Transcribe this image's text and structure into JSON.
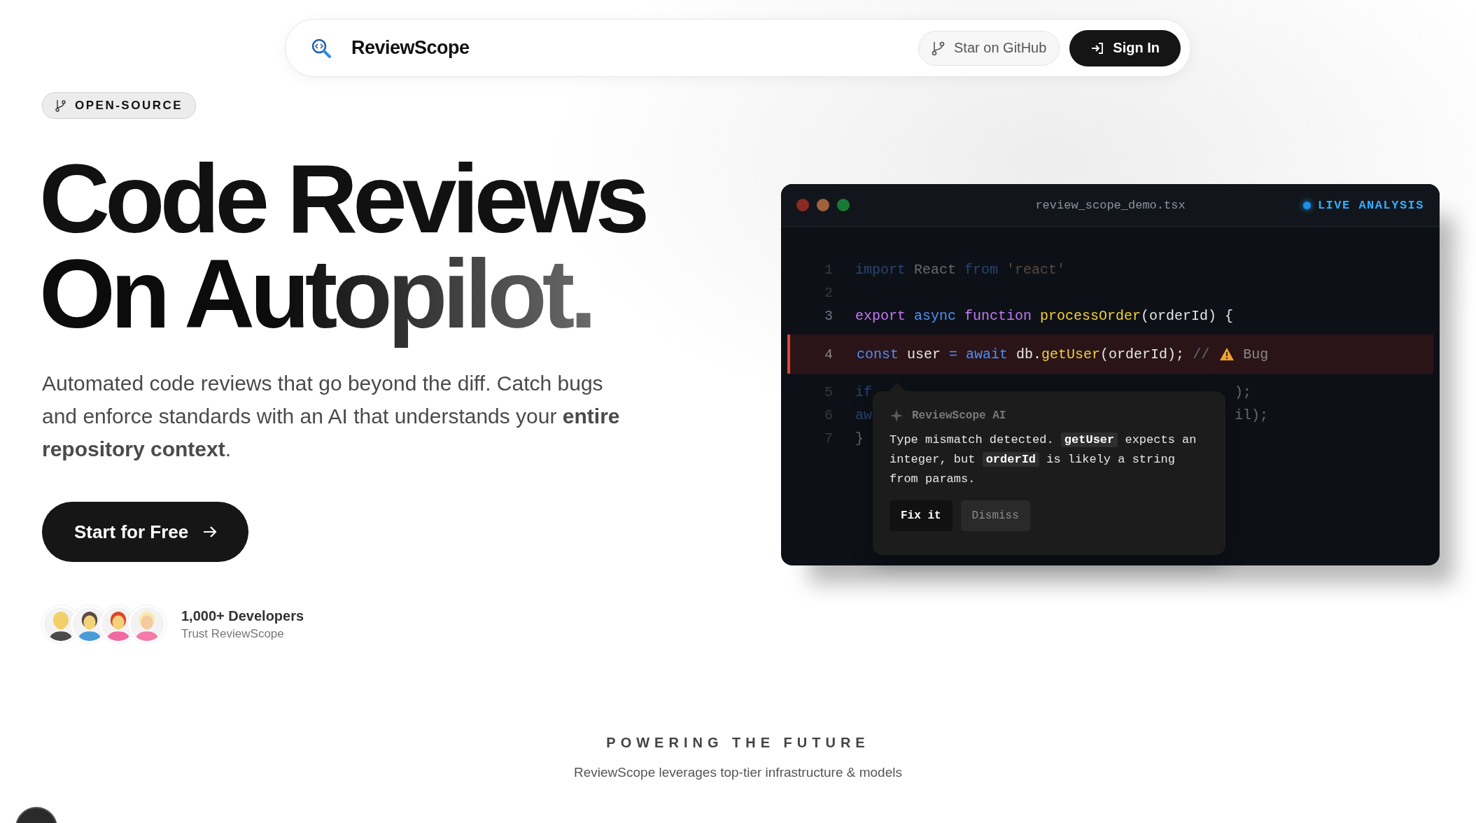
{
  "nav": {
    "brand": "ReviewScope",
    "github": "Star on GitHub",
    "signin": "Sign In"
  },
  "badge": "OPEN-SOURCE",
  "headline": [
    "Code Reviews",
    "On Autopilot."
  ],
  "intro": "Automated code reviews that go beyond the diff. Catch bugs and enforce standards with an AI that understands your **entire repository context**.",
  "cta": "Start for Free",
  "social": {
    "avatars": [
      {
        "kind": "avatar"
      },
      {
        "kind": "avatar"
      },
      {
        "kind": "avatar"
      },
      {
        "kind": "avatar"
      }
    ],
    "title": "1,000+ Developers",
    "subtitle": "Trust ReviewScope"
  },
  "editor": {
    "filename": "review_scope_demo.tsx",
    "status": "LIVE ANALYSIS",
    "lines": [
      {
        "number": "1",
        "dimmed": true,
        "highlighted": false,
        "tokens": [
          {
            "kind": "keyword",
            "text": "import"
          },
          {
            "kind": "plain",
            "text": " React "
          },
          {
            "kind": "keyword",
            "text": "from"
          },
          {
            "kind": "string",
            "text": " 'react'"
          }
        ]
      },
      {
        "number": "2",
        "dimmed": true,
        "highlighted": false
      },
      {
        "number": "3",
        "dimmed": false,
        "highlighted": false,
        "tokens": [
          {
            "kind": "control",
            "text": "export"
          },
          {
            "kind": "keyword",
            "text": " async"
          },
          {
            "kind": "control",
            "text": " function"
          },
          {
            "kind": "function",
            "text": " processOrder"
          },
          {
            "kind": "plain",
            "text": "(orderId) {"
          }
        ]
      },
      {
        "number": "4",
        "dimmed": false,
        "highlighted": true,
        "annotation": "Bug",
        "tokens": [
          {
            "kind": "keyword",
            "text": "const"
          },
          {
            "kind": "plain",
            "text": " user "
          },
          {
            "kind": "keyword",
            "text": "="
          },
          {
            "kind": "keyword",
            "text": " await"
          },
          {
            "kind": "plain",
            "text": " db."
          },
          {
            "kind": "function",
            "text": "getUser"
          },
          {
            "kind": "plain",
            "text": "(orderId);"
          },
          {
            "kind": "comment",
            "text": " //"
          }
        ]
      },
      {
        "number": "5",
        "dimmed": true,
        "highlighted": false,
        "tokens": [
          {
            "kind": "keyword",
            "text": "if"
          }
        ],
        "tail": [
          {
            "kind": "plain",
            "text": ");"
          }
        ]
      },
      {
        "number": "6",
        "dimmed": true,
        "highlighted": false,
        "tokens": [
          {
            "kind": "keyword",
            "text": "aw"
          }
        ],
        "tail": [
          {
            "kind": "plain",
            "text": "il);"
          }
        ]
      },
      {
        "number": "7",
        "dimmed": true,
        "highlighted": false,
        "tokens": [
          {
            "kind": "plain",
            "text": "}"
          }
        ]
      }
    ],
    "tooltip": {
      "header": "ReviewScope AI",
      "message": [
        {
          "kind": "plain",
          "text": "Type mismatch detected. "
        },
        {
          "kind": "code",
          "text": "getUser"
        },
        {
          "kind": "plain",
          "text": " expects an integer, but "
        },
        {
          "kind": "code",
          "text": "orderId"
        },
        {
          "kind": "plain",
          "text": " is likely a string from params."
        }
      ],
      "buttons": [
        {
          "kind": "primary",
          "label": "Fix it"
        },
        {
          "kind": "secondary",
          "label": "Dismiss"
        }
      ]
    }
  },
  "footer": {
    "title": "POWERING THE FUTURE",
    "subtitle": "ReviewScope leverages top-tier infrastructure & models"
  }
}
